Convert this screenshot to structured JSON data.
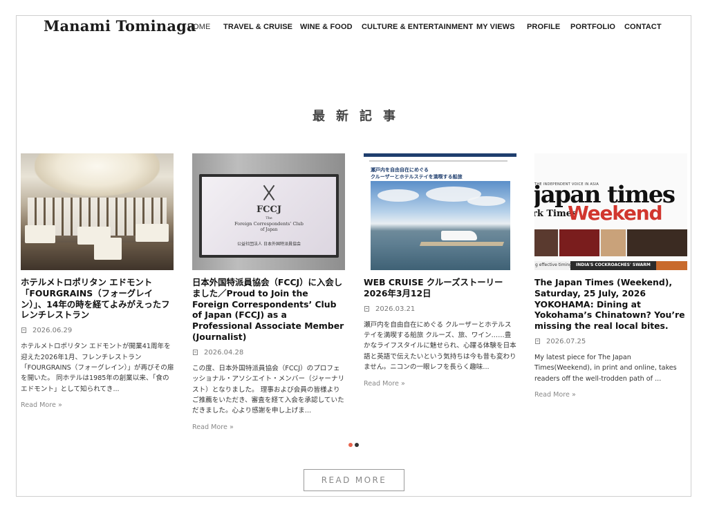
{
  "site": {
    "logo": "Manami Tominaga"
  },
  "nav": [
    {
      "label": "HOME",
      "active": true
    },
    {
      "label": "TRAVEL & CRUISE"
    },
    {
      "label": "WINE & FOOD"
    },
    {
      "label": "CULTURE & ENTERTAINMENT"
    },
    {
      "label": "MY VIEWS"
    },
    {
      "label": "PROFILE"
    },
    {
      "label": "PORTFOLIO"
    },
    {
      "label": "CONTACT"
    }
  ],
  "section": {
    "title": "最新記事"
  },
  "posts": [
    {
      "title": "ホテルメトロポリタン エドモント「FOURGRAINS（フォーグレイン）」、14年の時を経てよみがえったフレンチレストラン",
      "date": "2026.06.29",
      "excerpt": "ホテルメトロポリタン エドモントが開業41周年を迎えた2026年1月、フレンチレストラン「FOURGRAINS（フォーグレイン）」が再びその扉を開いた。 同ホテルは1985年の創業以来、「食のエドモント」として知られてき...",
      "more": "Read More »",
      "image_icon": "restaurant-photo"
    },
    {
      "title": "日本外国特派員協会（FCCJ）に入会しました／Proud to Join the Foreign Correspondents’ Club of Japan (FCCJ) as a Professional Associate Member (Journalist)",
      "date": "2026.04.28",
      "excerpt": "この度、日本外国特派員協会（FCCJ）のプロフェッショナル・アソシエイト・メンバー（ジャーナリスト）となりました。 理事および会員の皆様よりご推薦をいただき、審査を経て入会を承認していただきました。心より感謝を申し上げま...",
      "more": "Read More »",
      "image_icon": "fccj-plaque-photo",
      "image_text": {
        "abbr": "FCCJ",
        "line1": "The",
        "line2": "Foreign Correspondents’ Club",
        "line3": "of Japan",
        "jp": "公益社団法人 日本外国特派員協会"
      }
    },
    {
      "title": "WEB CRUISE クルーズストーリー 2026年3月12日",
      "date": "2026.03.21",
      "excerpt": "瀬戸内を自由自在にめぐる クルーザーとホテルステイを満喫する船旅 クルーズ、旅、ワイン……豊かなライフスタイルに魅せられ、心躍る体験を日本語と英語で伝えたいという気持ちは今も昔も変わりません。ニコンの一眼レフを長らく趣味...",
      "more": "Read More »",
      "image_icon": "cruise-page-photo",
      "image_text": {
        "head1": "瀬戸内を自由自在にめぐる",
        "head2": "クルーザーとホテルステイを満喫する船旅"
      }
    },
    {
      "title": "The Japan Times (Weekend), Saturday, 25 July, 2026 YOKOHAMA: Dining at Yokohama’s Chinatown? You’re missing the real local bites.",
      "date": "2026.07.25",
      "excerpt": "My latest piece for The Japan Times(Weekend), in print and online, takes readers off the well-trodden path of ...",
      "more": "Read More »",
      "image_icon": "newspaper-photo",
      "image_text": {
        "tagline": "THE INDEPENDENT VOICE IN ASIA",
        "logo": "japan times",
        "weekend": "Weekend",
        "rk": "rk Times",
        "foot1": "g effective timing",
        "foot2": "INDIA'S COCKROACHES' SWARM"
      }
    }
  ],
  "carousel": {
    "dot_active_color": "#e8644d",
    "dot_inactive_color": "#333333"
  },
  "read_more_button": {
    "label": "READ MORE"
  }
}
